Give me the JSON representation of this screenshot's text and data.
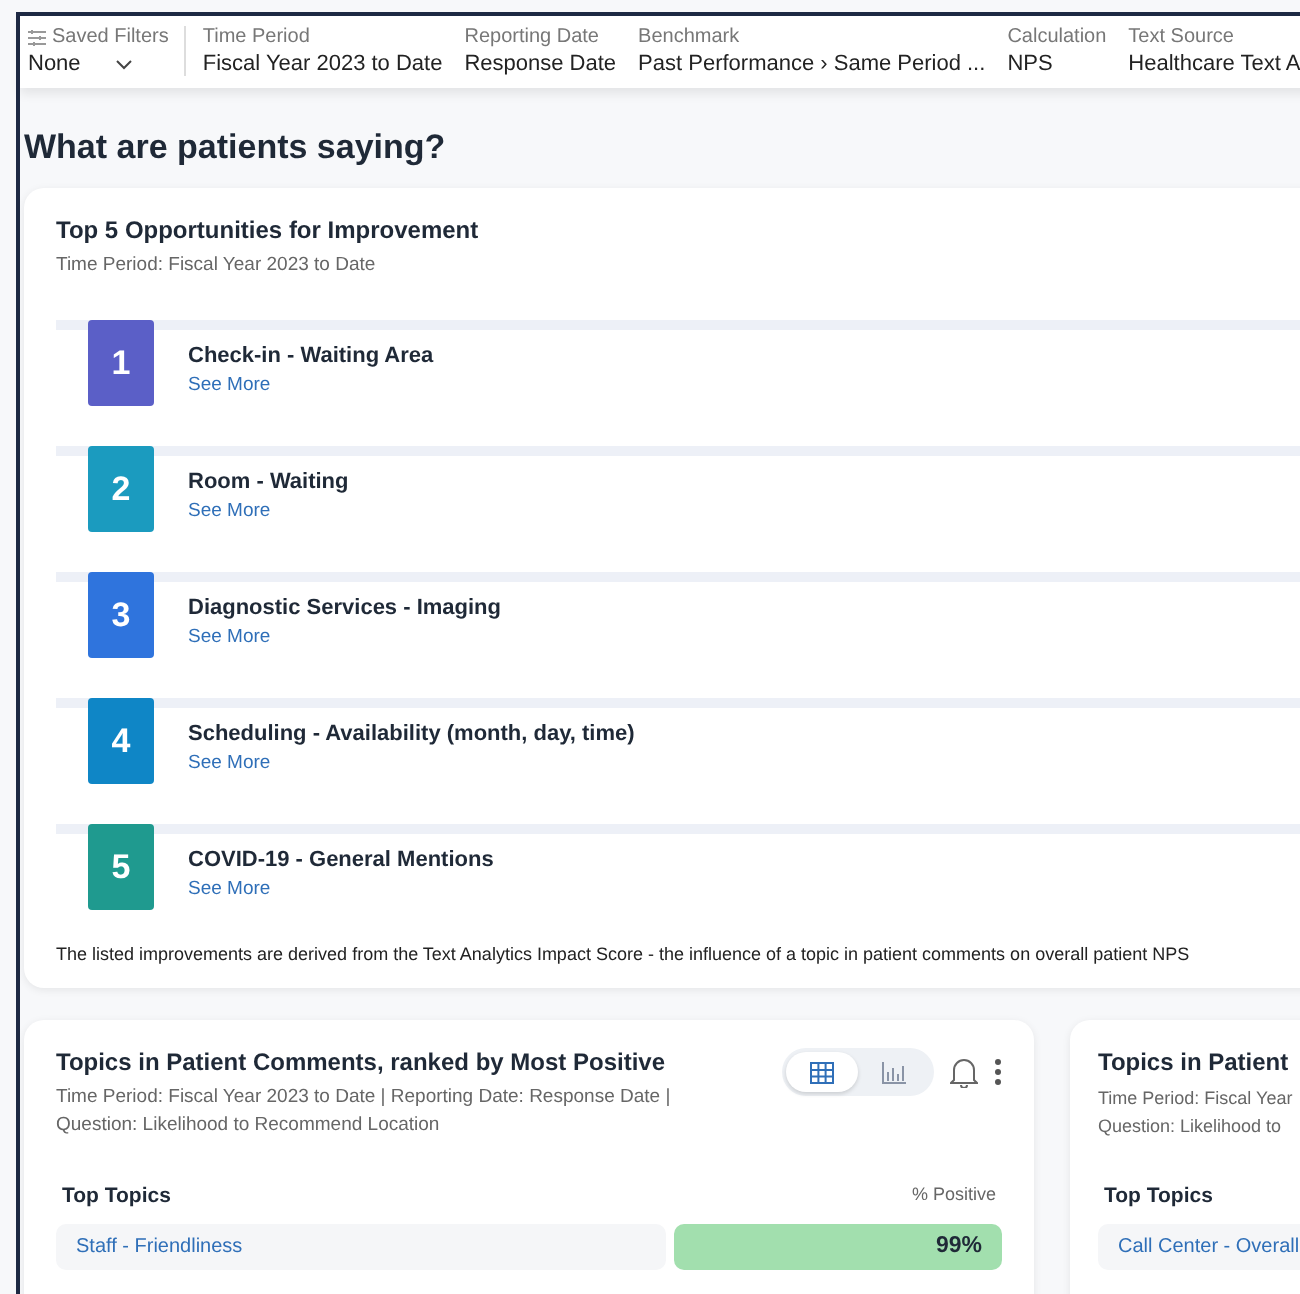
{
  "filters": [
    {
      "label": "Saved Filters",
      "value": "None",
      "kind": "dropdown"
    },
    {
      "label": "Time Period",
      "value": "Fiscal Year 2023 to Date",
      "kind": "plain"
    },
    {
      "label": "Reporting Date",
      "value": "Response Date",
      "kind": "plain"
    },
    {
      "label": "Benchmark",
      "value": "Past Performance › Same Period ...",
      "kind": "plain"
    },
    {
      "label": "Calculation",
      "value": "NPS",
      "kind": "plain"
    },
    {
      "label": "Text Source",
      "value": "Healthcare Text A",
      "kind": "plain"
    }
  ],
  "heading": "What are patients saying?",
  "opportunities": {
    "title": "Top 5 Opportunities for Improvement",
    "subtitle": "Time Period: Fiscal Year 2023 to Date",
    "items": [
      {
        "rank": "1",
        "name": "Check-in - Waiting Area",
        "link": "See More",
        "color": "#5b5fc7"
      },
      {
        "rank": "2",
        "name": "Room - Waiting",
        "link": "See More",
        "color": "#1b9bbf"
      },
      {
        "rank": "3",
        "name": "Diagnostic Services - Imaging",
        "link": "See More",
        "color": "#2f74dd"
      },
      {
        "rank": "4",
        "name": "Scheduling - Availability (month, day, time)",
        "link": "See More",
        "color": "#0f86c6"
      },
      {
        "rank": "5",
        "name": "COVID-19 - General Mentions",
        "link": "See More",
        "color": "#1f9a8f"
      }
    ],
    "footnote": "The listed improvements are derived from the Text Analytics Impact Score - the influence of a topic in patient comments on overall patient NPS"
  },
  "topic_cards": [
    {
      "title": "Topics in Patient Comments, ranked by Most Positive",
      "subtitle": "Time Period: Fiscal Year 2023 to Date | Reporting Date: Response Date |",
      "question": "Question: Likelihood to Recommend Location",
      "views": [
        {
          "kind": "table",
          "selected": true
        },
        {
          "kind": "chart",
          "selected": false
        }
      ],
      "columns": [
        "Top Topics",
        "% Positive"
      ],
      "rows": [
        {
          "topic": "Staff - Friendliness",
          "value": "99%"
        }
      ]
    },
    {
      "title": "Topics in Patient",
      "subtitle": "Time Period: Fiscal Year",
      "question": "Question: Likelihood to",
      "columns": [
        "Top Topics"
      ],
      "rows": [
        {
          "topic": "Call Center - Overall"
        }
      ]
    }
  ]
}
